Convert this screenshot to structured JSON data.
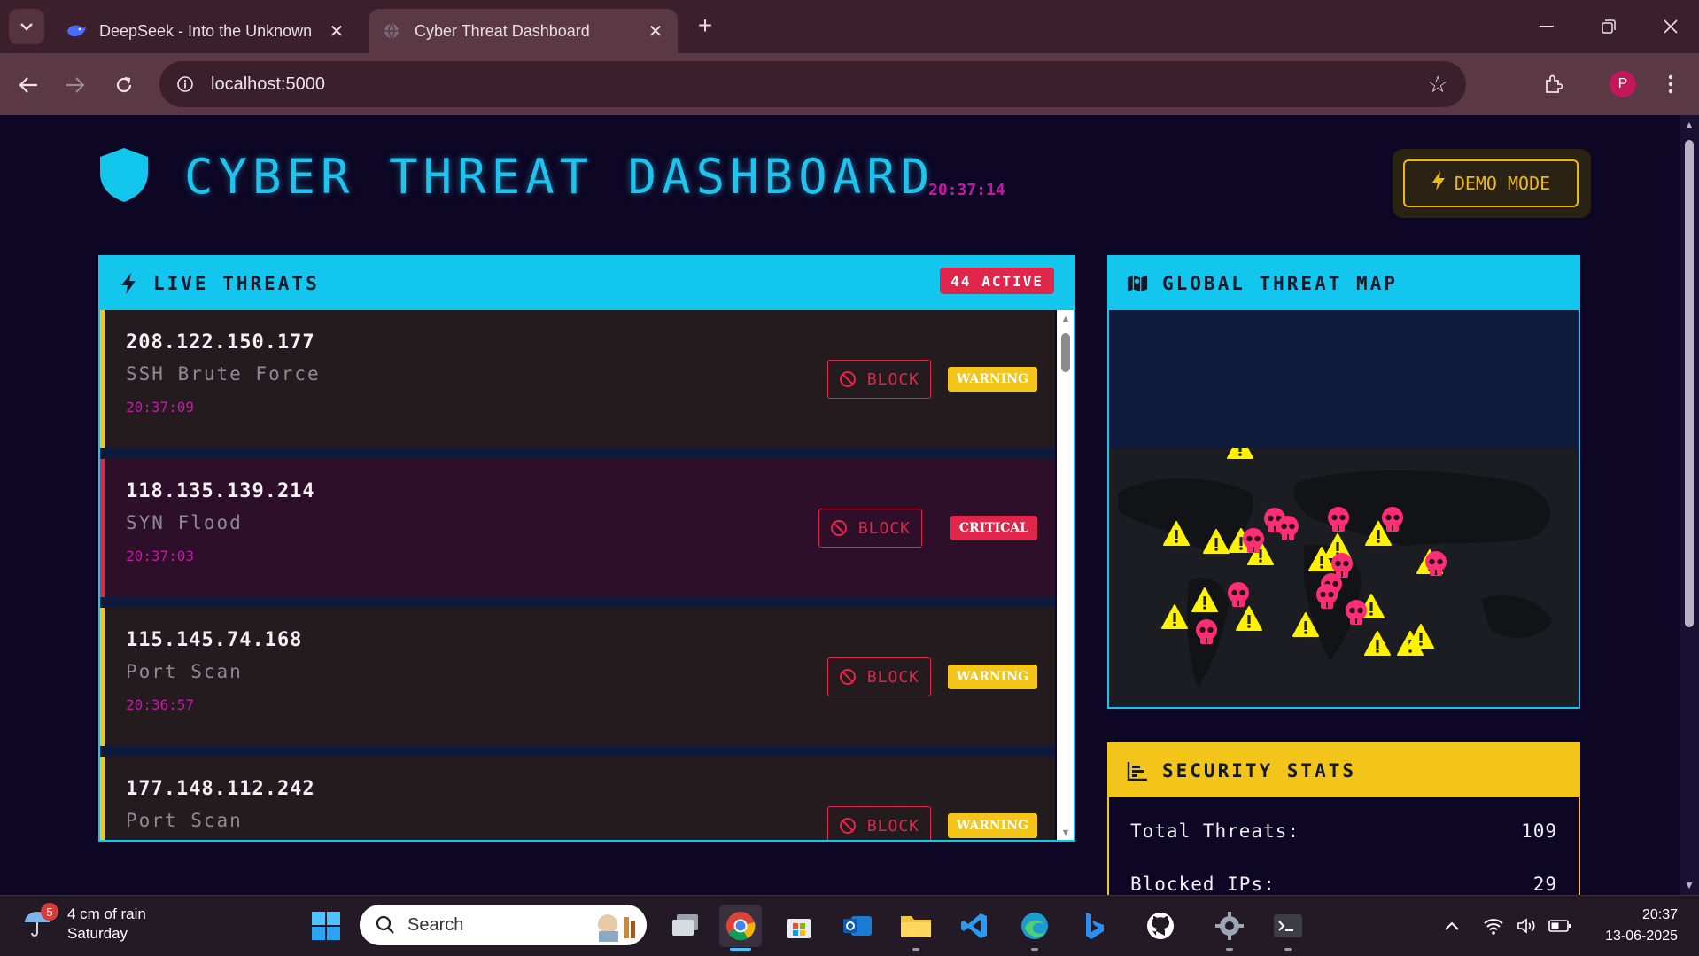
{
  "browser": {
    "tabs": [
      {
        "title": "DeepSeek - Into the Unknown",
        "active": false,
        "favicon": "deepseek-whale-icon"
      },
      {
        "title": "Cyber Threat Dashboard",
        "active": true,
        "favicon": "globe-icon"
      }
    ],
    "url": "localhost:5000",
    "profile_initial": "P"
  },
  "header": {
    "title": "CYBER THREAT DASHBOARD",
    "clock": "20:37:14",
    "demo_label": "DEMO MODE"
  },
  "threats_panel": {
    "title": "LIVE THREATS",
    "active_badge": "44 ACTIVE",
    "block_label": "BLOCK",
    "items": [
      {
        "ip": "208.122.150.177",
        "type": "SSH Brute Force",
        "time": "20:37:09",
        "severity": "WARNING",
        "level": "warning"
      },
      {
        "ip": "118.135.139.214",
        "type": "SYN Flood",
        "time": "20:37:03",
        "severity": "CRITICAL",
        "level": "critical"
      },
      {
        "ip": "115.145.74.168",
        "type": "Port Scan",
        "time": "20:36:57",
        "severity": "WARNING",
        "level": "warning"
      },
      {
        "ip": "177.148.112.242",
        "type": "Port Scan",
        "time": "",
        "severity": "WARNING",
        "level": "warning"
      }
    ]
  },
  "map_panel": {
    "title": "GLOBAL THREAT MAP"
  },
  "stats_panel": {
    "title": "SECURITY STATS",
    "rows": [
      {
        "label": "Total Threats:",
        "value": "109"
      },
      {
        "label": "Blocked IPs:",
        "value": "29"
      }
    ]
  },
  "taskbar": {
    "weather_badge": "5",
    "weather_line1": "4 cm of rain",
    "weather_line2": "Saturday",
    "search_placeholder": "Search",
    "time": "20:37",
    "date": "13-06-2025"
  },
  "colors": {
    "accent_cyan": "#13c6ee",
    "warning_yellow": "#f3c51b",
    "critical_red": "#e0264a",
    "timestamp_magenta": "#c21aa6",
    "page_bg": "#0d0624"
  }
}
